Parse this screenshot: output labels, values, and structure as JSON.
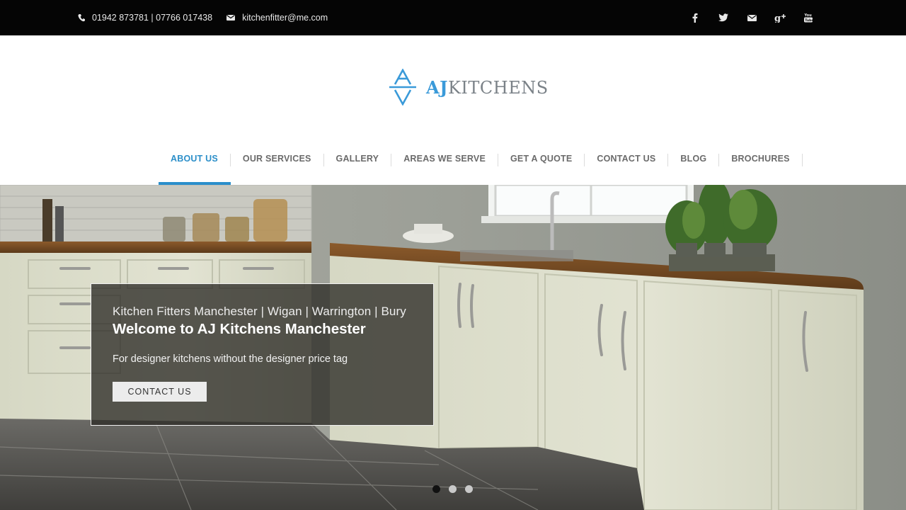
{
  "topbar": {
    "phone": "01942 873781 | 07766 017438",
    "email": "kitchenfitter@me.com",
    "phone_icon": "phone-icon",
    "email_icon": "envelope-icon",
    "social_icons": [
      "facebook-icon",
      "twitter-icon",
      "mail-icon",
      "google-plus-icon",
      "youtube-icon"
    ]
  },
  "logo": {
    "brand_bold": "AJ",
    "brand_rest": "KITCHENS",
    "mark_icon": "aj-monogram-icon"
  },
  "nav": {
    "items": [
      {
        "label": "ABOUT US",
        "active": true
      },
      {
        "label": "OUR SERVICES",
        "active": false
      },
      {
        "label": "GALLERY",
        "active": false
      },
      {
        "label": "AREAS WE SERVE",
        "active": false
      },
      {
        "label": "GET A QUOTE",
        "active": false
      },
      {
        "label": "CONTACT US",
        "active": false
      },
      {
        "label": "BLOG",
        "active": false
      },
      {
        "label": "BROCHURES",
        "active": false
      }
    ]
  },
  "hero": {
    "subtitle": "Kitchen Fitters Manchester | Wigan | Warrington | Bury",
    "title": "Welcome to AJ Kitchens Manchester",
    "tagline": "For designer kitchens without the designer price tag",
    "button_label": "CONTACT US",
    "slide_count": 3,
    "active_slide": 1
  },
  "colors": {
    "accent": "#2a8ecb",
    "topbar_bg": "#050505",
    "nav_text": "#6a6a6a"
  }
}
